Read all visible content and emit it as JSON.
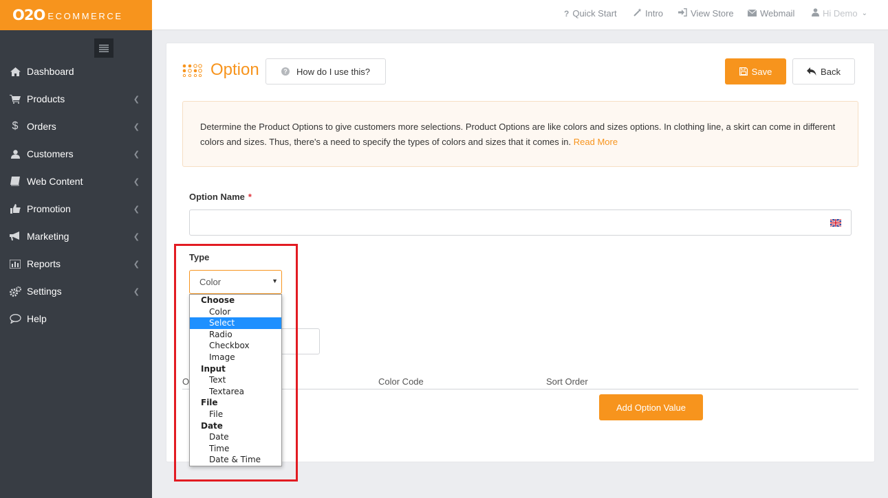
{
  "brand": {
    "logo": "O2O",
    "suffix": "ECOMMERCE",
    "color": "#f7941d"
  },
  "sidebar": {
    "items": [
      {
        "label": "Dashboard",
        "icon": "home-icon",
        "has_submenu": false
      },
      {
        "label": "Products",
        "icon": "cart-icon",
        "has_submenu": true
      },
      {
        "label": "Orders",
        "icon": "dollar-icon",
        "has_submenu": true
      },
      {
        "label": "Customers",
        "icon": "user-icon",
        "has_submenu": true
      },
      {
        "label": "Web Content",
        "icon": "book-icon",
        "has_submenu": true
      },
      {
        "label": "Promotion",
        "icon": "thumbs-up-icon",
        "has_submenu": true
      },
      {
        "label": "Marketing",
        "icon": "bullhorn-icon",
        "has_submenu": true
      },
      {
        "label": "Reports",
        "icon": "bar-chart-icon",
        "has_submenu": true
      },
      {
        "label": "Settings",
        "icon": "gears-icon",
        "has_submenu": true
      },
      {
        "label": "Help",
        "icon": "comment-icon",
        "has_submenu": false
      }
    ]
  },
  "topbar": {
    "quick_start": "Quick Start",
    "intro": "Intro",
    "view_store": "View Store",
    "webmail": "Webmail",
    "user": "Hi Demo"
  },
  "page": {
    "title": "Option",
    "help_label": "How do I use this?",
    "save_label": "Save",
    "back_label": "Back",
    "info_text": "Determine the Product Options to give customers more selections. Product Options are like colors and sizes options. In clothing line, a skirt can come in different colors and sizes. Thus, there's a need to specify the types of colors and sizes that it comes in.",
    "read_more": "Read More"
  },
  "form": {
    "option_name_label": "Option Name",
    "required_mark": "*",
    "option_name_value": "",
    "type_label": "Type",
    "type_selected": "Color",
    "dropdown_groups": [
      {
        "label": "Choose",
        "options": [
          "Color",
          "Select",
          "Radio",
          "Checkbox",
          "Image"
        ]
      },
      {
        "label": "Input",
        "options": [
          "Text",
          "Textarea"
        ]
      },
      {
        "label": "File",
        "options": [
          "File"
        ]
      },
      {
        "label": "Date",
        "options": [
          "Date",
          "Time",
          "Date & Time"
        ]
      }
    ],
    "highlighted_option": "Select"
  },
  "table": {
    "col_first_partial": "O",
    "col_color_code": "Color Code",
    "col_sort_order": "Sort Order",
    "add_button": "Add Option Value"
  },
  "colors": {
    "accent": "#f7941d",
    "sidebar": "#383d44",
    "highlight_box": "#e21b22",
    "dropdown_selected": "#1e90ff"
  }
}
